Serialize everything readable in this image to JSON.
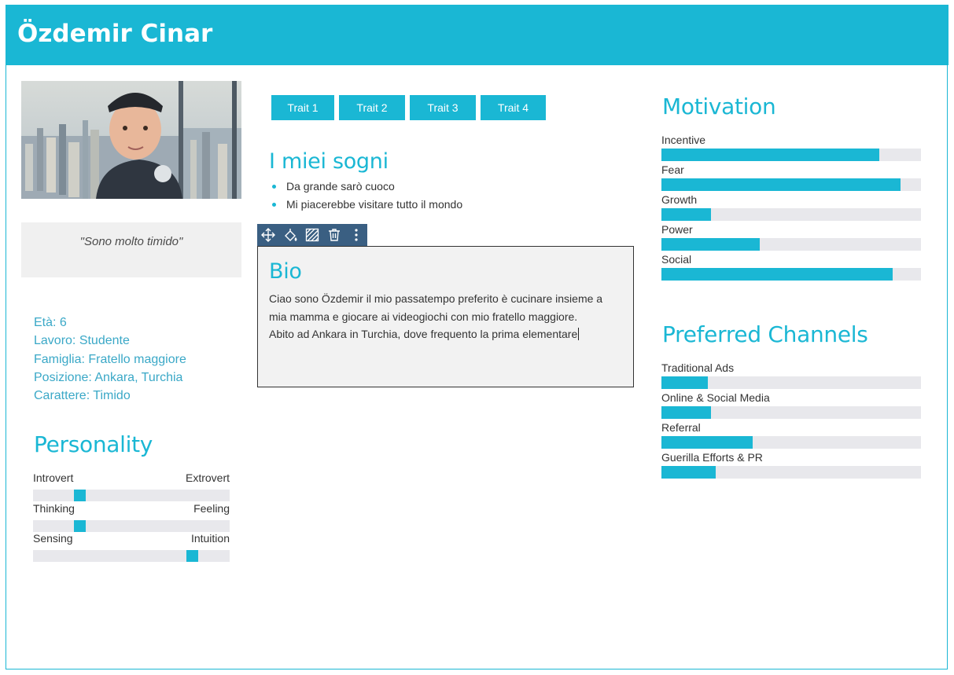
{
  "header": {
    "name": "Özdemir Cinar"
  },
  "colors": {
    "accent": "#1ab7d4",
    "toolbar": "#3a5f82",
    "track": "#e8e8ec",
    "panel": "#f0f0f0"
  },
  "photo": {
    "icon": "profile-photo"
  },
  "quote": "\"Sono molto timido\"",
  "facts": {
    "age": "Età: 6",
    "job": "Lavoro: Studente",
    "family": "Famiglia: Fratello maggiore",
    "location": "Posizione: Ankara, Turchia",
    "character": "Carattere: Timido"
  },
  "personality": {
    "title": "Personality",
    "items": [
      {
        "left": "Introvert",
        "right": "Extrovert",
        "value": 0.22
      },
      {
        "left": "Thinking",
        "right": "Feeling",
        "value": 0.22
      },
      {
        "left": "Sensing",
        "right": "Intuition",
        "value": 0.83
      }
    ]
  },
  "traits": [
    "Trait 1",
    "Trait 2",
    "Trait 3",
    "Trait 4"
  ],
  "dreams": {
    "title": "I miei sogni",
    "items": [
      "Da grande sarò cuoco",
      "Mi piacerebbe visitare tutto il mondo"
    ]
  },
  "toolbar": {
    "icons": [
      "move-icon",
      "fill-color-icon",
      "pattern-icon",
      "trash-icon",
      "more-vertical-icon"
    ]
  },
  "bio": {
    "title": "Bio",
    "text_line1": "Ciao sono Özdemir il mio passatempo preferito è cucinare insieme a mia mamma e giocare ai videogiochi con mio fratello maggiore.",
    "text_line2": "Abito ad Ankara in Turchia, dove frequento la prima elementare"
  },
  "motivation": {
    "title": "Motivation",
    "items": [
      {
        "label": "Incentive",
        "value": 0.84
      },
      {
        "label": "Fear",
        "value": 0.92
      },
      {
        "label": "Growth",
        "value": 0.19
      },
      {
        "label": "Power",
        "value": 0.38
      },
      {
        "label": "Social",
        "value": 0.89
      }
    ]
  },
  "channels": {
    "title": "Preferred Channels",
    "items": [
      {
        "label": "Traditional Ads",
        "value": 0.18
      },
      {
        "label": "Online & Social Media",
        "value": 0.19
      },
      {
        "label": "Referral",
        "value": 0.35
      },
      {
        "label": "Guerilla Efforts & PR",
        "value": 0.21
      }
    ]
  }
}
